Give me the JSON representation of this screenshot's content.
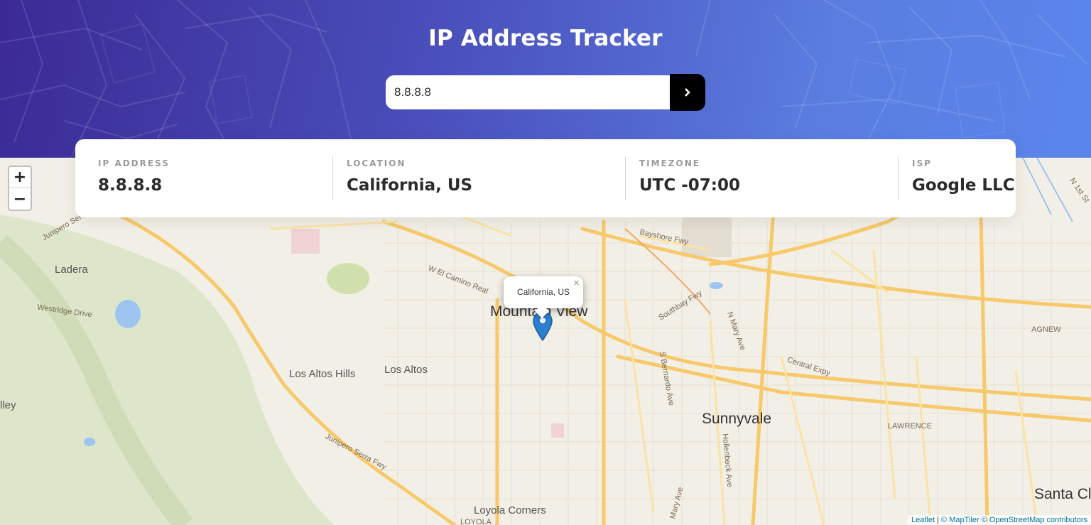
{
  "header": {
    "title": "IP Address Tracker"
  },
  "search": {
    "value": "8.8.8.8",
    "button_icon": "chevron-right-icon"
  },
  "info": {
    "ip_label": "IP ADDRESS",
    "ip_value": "8.8.8.8",
    "location_label": "LOCATION",
    "location_value": "California, US",
    "timezone_label": "TIMEZONE",
    "timezone_value": "UTC -07:00",
    "isp_label": "ISP",
    "isp_value": "Google LLC"
  },
  "map": {
    "zoom_in": "+",
    "zoom_out": "−",
    "popup_text": "California, US",
    "popup_close": "×",
    "marker_icon": "map-pin-icon",
    "places": {
      "mountain_view": "Mountain View",
      "sunnyvale": "Sunnyvale",
      "los_altos": "Los Altos",
      "los_altos_hills": "Los Altos Hills",
      "ladera": "Ladera",
      "loyola_corners": "Loyola Corners",
      "santa_clara": "Santa Cl",
      "valley": "lley",
      "westridge": "Westridge Drive",
      "w_el_camino": "W El Camino Real",
      "bayshore": "Bayshore Fwy",
      "southbay": "Southbay Fwy",
      "central_expy": "Central Expy",
      "junipero_1": "Junipero Serra Fwy",
      "junipero_2": "Junipero Serra Fwy",
      "lawrence": "LAWRENCE",
      "agnew": "AGNEW",
      "s_bernardo": "S Bernardo Ave",
      "hollenbeck": "Hollenbeck Ave",
      "n_mary": "N Mary Ave",
      "loyola": "LOYOLA",
      "mary_ave": "Mary Ave",
      "n_1st": "N 1st St"
    },
    "attribution": {
      "leaflet": "Leaflet",
      "sep": " | ",
      "maptiler": "© MapTiler",
      "osm": "© OpenStreetMap contributors"
    }
  }
}
